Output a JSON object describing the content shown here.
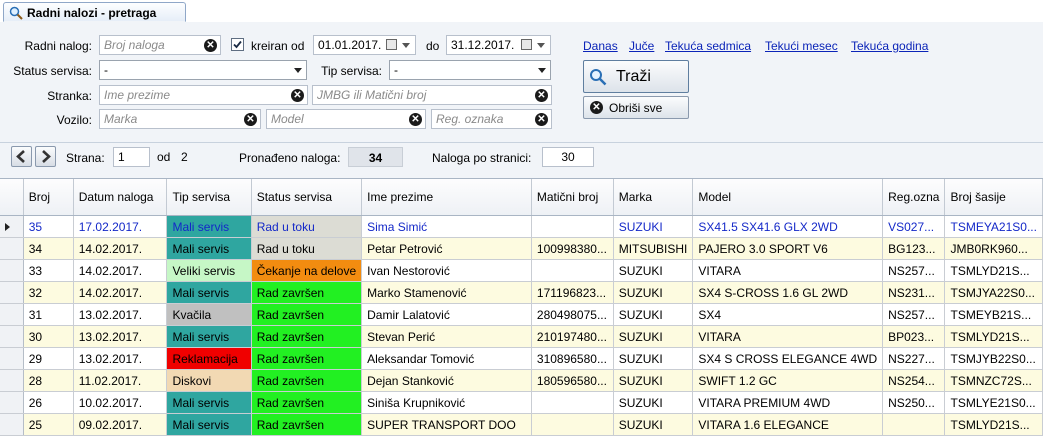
{
  "tab": {
    "title": "Radni nalozi - pretraga"
  },
  "filters": {
    "radni_nalog_label": "Radni nalog:",
    "radni_nalog_placeholder": "Broj naloga",
    "kreiran_od_label": "kreiran od",
    "date_from": "01.01.2017.",
    "do_label": "do",
    "date_to": "31.12.2017.",
    "status_servisa_label": "Status servisa:",
    "status_servisa_value": "-",
    "tip_servisa_label": "Tip servisa:",
    "tip_servisa_value": "-",
    "stranka_label": "Stranka:",
    "ime_placeholder": "Ime prezime",
    "jmbg_placeholder": "JMBG ili Matični broj",
    "vozilo_label": "Vozilo:",
    "marka_placeholder": "Marka",
    "model_placeholder": "Model",
    "reg_placeholder": "Reg. oznaka"
  },
  "quick_links": [
    "Danas",
    "Juče",
    "Tekuća sedmica",
    "Tekući mesec",
    "Tekuća godina"
  ],
  "buttons": {
    "trazi": "Traži",
    "obrisi": "Obriši sve"
  },
  "pager": {
    "strana_label": "Strana:",
    "page": "1",
    "od_label": "od",
    "total_pages": "2",
    "found_label": "Pronađeno naloga:",
    "found": "34",
    "per_page_label": "Naloga po stranici:",
    "per_page": "30"
  },
  "colors": {
    "mali_servis": "#2fa6a0",
    "veliki_servis": "#c6f7c6",
    "kvacila": "#c0c0c0",
    "reklamacija": "#f00000",
    "diskovi": "#f2d9b3",
    "rad_u_toku": "#dcdcd4",
    "cekanje": "#f28c10",
    "rad_zavrsen": "#22f022",
    "row_alt": "#fdfbe0"
  },
  "table": {
    "columns": [
      "Broj",
      "Datum naloga",
      "Tip servisa",
      "Status servisa",
      "Ime prezime",
      "Matični broj",
      "Marka",
      "Model",
      "Reg.ozna",
      "Broj šasije"
    ],
    "rows": [
      {
        "broj": "35",
        "datum": "17.02.2017.",
        "tip": "Mali servis",
        "tip_color": "#2fa6a0",
        "status": "Rad u toku",
        "status_color": "#dcdcd4",
        "ime": "Sima Simić",
        "mb": "",
        "marka": "SUZUKI",
        "model": "SX41.5 SX41.6 GLX 2WD",
        "reg": "VS027...",
        "sasija": "TSMEYA21S0..."
      },
      {
        "broj": "34",
        "datum": "14.02.2017.",
        "tip": "Mali servis",
        "tip_color": "#2fa6a0",
        "status": "Rad u toku",
        "status_color": "#dcdcd4",
        "ime": "Petar Petrović",
        "mb": "100998380...",
        "marka": "MITSUBISHI",
        "model": "PAJERO 3.0 SPORT V6",
        "reg": "BG123...",
        "sasija": "JMB0RK960..."
      },
      {
        "broj": "33",
        "datum": "14.02.2017.",
        "tip": "Veliki servis",
        "tip_color": "#c6f7c6",
        "status": "Čekanje na delove",
        "status_color": "#f28c10",
        "ime": "Ivan Nestorović",
        "mb": "",
        "marka": "SUZUKI",
        "model": "VITARA",
        "reg": "NS257...",
        "sasija": "TSMLYD21S..."
      },
      {
        "broj": "32",
        "datum": "14.02.2017.",
        "tip": "Mali servis",
        "tip_color": "#2fa6a0",
        "status": "Rad završen",
        "status_color": "#22f022",
        "ime": "Marko Stamenović",
        "mb": "171196823...",
        "marka": "SUZUKI",
        "model": "SX4 S-CROSS 1.6 GL 2WD",
        "reg": "NS231...",
        "sasija": "TSMJYA22S0..."
      },
      {
        "broj": "31",
        "datum": "13.02.2017.",
        "tip": "Kvačila",
        "tip_color": "#c0c0c0",
        "status": "Rad završen",
        "status_color": "#22f022",
        "ime": "Damir Lalatović",
        "mb": "280498075...",
        "marka": "SUZUKI",
        "model": "SX4",
        "reg": "NS257...",
        "sasija": "TSMEYB21S..."
      },
      {
        "broj": "30",
        "datum": "13.02.2017.",
        "tip": "Mali servis",
        "tip_color": "#2fa6a0",
        "status": "Rad završen",
        "status_color": "#22f022",
        "ime": "Stevan Perić",
        "mb": "210197480...",
        "marka": "SUZUKI",
        "model": "VITARA",
        "reg": "BP023...",
        "sasija": "TSMLYD21S..."
      },
      {
        "broj": "29",
        "datum": "13.02.2017.",
        "tip": "Reklamacija",
        "tip_color": "#f00000",
        "status": "Rad završen",
        "status_color": "#22f022",
        "ime": "Aleksandar Tomović",
        "mb": "310896580...",
        "marka": "SUZUKI",
        "model": "SX4 S CROSS ELEGANCE 4WD",
        "reg": "NS227...",
        "sasija": "TSMJYB22S0..."
      },
      {
        "broj": "28",
        "datum": "11.02.2017.",
        "tip": "Diskovi",
        "tip_color": "#f2d9b3",
        "status": "Rad završen",
        "status_color": "#22f022",
        "ime": "Dejan Stanković",
        "mb": "180596580...",
        "marka": "SUZUKI",
        "model": "SWIFT 1.2 GC",
        "reg": "NS254...",
        "sasija": "TSMNZC72S..."
      },
      {
        "broj": "26",
        "datum": "10.02.2017.",
        "tip": "Mali servis",
        "tip_color": "#2fa6a0",
        "status": "Rad završen",
        "status_color": "#22f022",
        "ime": "Siniša Krupniković",
        "mb": "",
        "marka": "SUZUKI",
        "model": "VITARA PREMIUM 4WD",
        "reg": "NS250...",
        "sasija": "TSMLYE21S0..."
      },
      {
        "broj": "25",
        "datum": "09.02.2017.",
        "tip": "Mali servis",
        "tip_color": "#2fa6a0",
        "status": "Rad završen",
        "status_color": "#22f022",
        "ime": "SUPER TRANSPORT DOO",
        "mb": "",
        "marka": "SUZUKI",
        "model": "VITARA 1.6 ELEGANCE",
        "reg": "",
        "sasija": "TSMLYD21S..."
      }
    ]
  }
}
